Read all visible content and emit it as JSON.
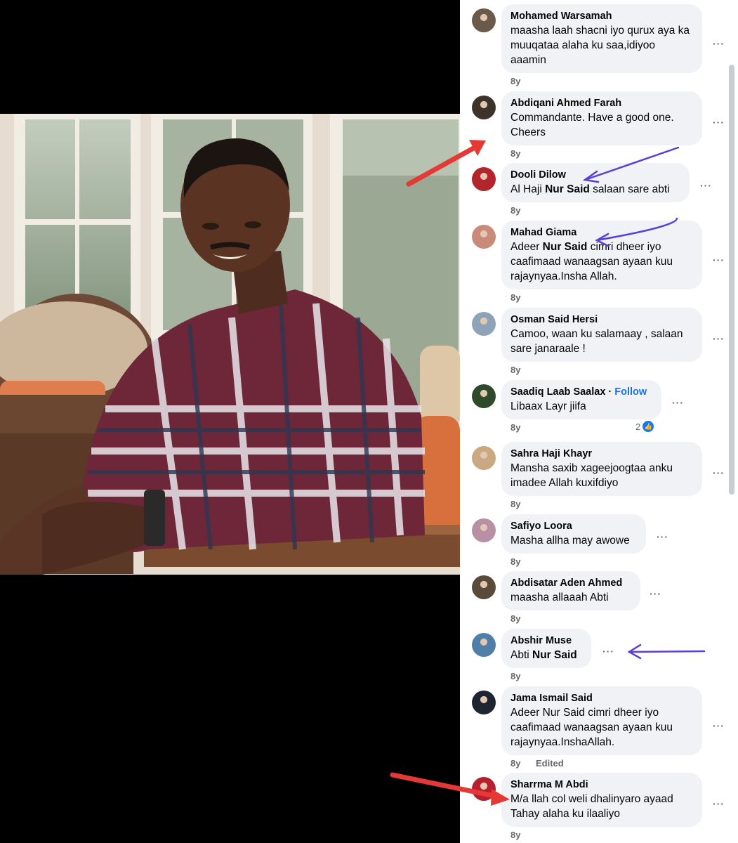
{
  "photo": {
    "description_icon": "photo"
  },
  "comments": [
    {
      "author": "Mohamed Warsamah",
      "text": "maasha laah shacni iyo qurux aya ka muuqataa alaha ku saa,idiyoo aaamin",
      "time": "8y",
      "avatar_color": "#6b5a4a"
    },
    {
      "author": "Abdiqani Ahmed Farah",
      "text": "Commandante. Have a good one. Cheers",
      "time": "8y",
      "avatar_color": "#3d3328"
    },
    {
      "author": "Dooli Dilow",
      "text_pre": "Al Haji ",
      "text_bold": "Nur Said",
      "text_post": " salaan sare abti",
      "time": "8y",
      "avatar_color": "#b3242b"
    },
    {
      "author": "Mahad Giama",
      "text_pre": "Adeer ",
      "text_bold": "Nur Said",
      "text_post": " cimri dheer iyo caafimaad wanaagsan ayaan kuu rajaynyaa.Insha Allah.",
      "time": "8y",
      "avatar_color": "#c98a7a"
    },
    {
      "author": "Osman Said Hersi",
      "text": "Camoo, waan ku salamaay , salaan sare janaraale !",
      "time": "8y",
      "avatar_color": "#8fa3b8"
    },
    {
      "author": "Saadiq Laab Saalax",
      "follow": "Follow",
      "separator": "·",
      "text": "Libaax Layr jiifa",
      "time": "8y",
      "reaction_count": "2",
      "avatar_color": "#2e4a2a"
    },
    {
      "author": "Sahra Haji Khayr",
      "text": "Mansha saxib xageejoogtaa anku imadee Allah kuxifdiyo",
      "time": "8y",
      "avatar_color": "#c9a882"
    },
    {
      "author": "Safiyo Loora",
      "text": "Masha allha may awowe",
      "time": "8y",
      "avatar_color": "#b98fa3"
    },
    {
      "author": "Abdisatar Aden Ahmed",
      "text": "maasha allaaah Abti",
      "time": "8y",
      "avatar_color": "#5a4a3a"
    },
    {
      "author": "Abshir Muse",
      "text_pre": "Abti ",
      "text_bold": "Nur Said",
      "text_post": "",
      "time": "8y",
      "avatar_color": "#4f7fa8"
    },
    {
      "author": "Jama Ismail Said",
      "text": "Adeer Nur Said cimri dheer iyo caafimaad wanaagsan ayaan kuu rajaynyaa.InshaAllah.",
      "time": "8y",
      "edited": "Edited",
      "avatar_color": "#1e2530"
    },
    {
      "author": "Sharrma M Abdi",
      "text": "M/a llah col weli dhalinyaro ayaad Tahay alaha ku ilaaliyo",
      "time": "8y",
      "avatar_color": "#b81f2e"
    }
  ],
  "more_label": "···",
  "colors": {
    "arrow_red": "#e53935",
    "arrow_purple": "#5b3fd6",
    "bubble": "#f0f2f5",
    "link": "#1b74e4"
  }
}
